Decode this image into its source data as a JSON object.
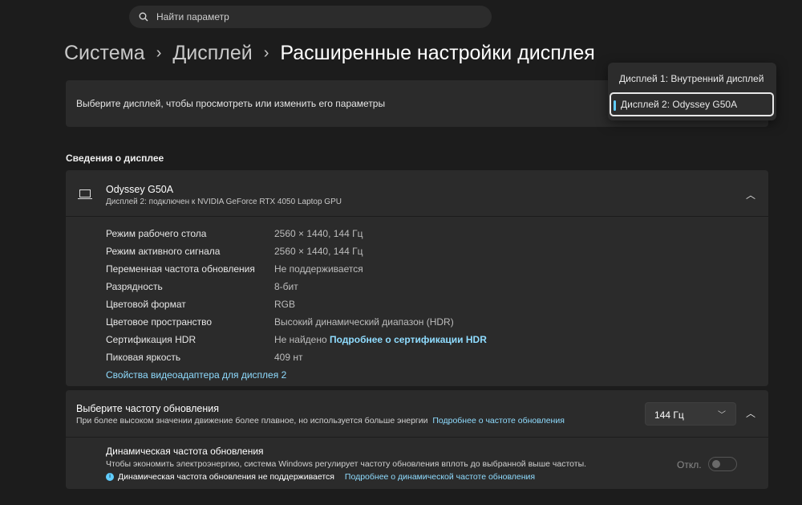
{
  "search": {
    "placeholder": "Найти параметр"
  },
  "breadcrumb": {
    "item1": "Система",
    "item2": "Дисплей",
    "current": "Расширенные настройки дисплея"
  },
  "display_select": {
    "label": "Выберите дисплей, чтобы просмотреть или изменить его параметры",
    "options": [
      "Дисплей 1: Внутренний дисплей",
      "Дисплей 2: Odyssey G50A"
    ],
    "selected": "Дисплей 2: Odyssey G50A"
  },
  "section_title": "Сведения о дисплее",
  "info": {
    "name": "Odyssey G50A",
    "subtitle": "Дисплей 2: подключен к NVIDIA GeForce RTX 4050 Laptop GPU",
    "rows": [
      {
        "k": "Режим рабочего стола",
        "v": "2560 × 1440, 144 Гц"
      },
      {
        "k": "Режим активного сигнала",
        "v": "2560 × 1440, 144 Гц"
      },
      {
        "k": "Переменная частота обновления",
        "v": "Не поддерживается"
      },
      {
        "k": "Разрядность",
        "v": "8-бит"
      },
      {
        "k": "Цветовой формат",
        "v": "RGB"
      },
      {
        "k": "Цветовое пространство",
        "v": "Высокий динамический диапазон (HDR)"
      },
      {
        "k": "Сертификация HDR",
        "v": "Не найдено",
        "link": "Подробнее о сертификации HDR"
      },
      {
        "k": "Пиковая яркость",
        "v": "409 нт"
      }
    ],
    "adapter_link": "Свойства видеоадаптера для дисплея 2"
  },
  "refresh": {
    "title": "Выберите частоту обновления",
    "desc": "При более высоком значении движение более плавное, но используется больше энергии",
    "link": "Подробнее о частоте обновления",
    "value": "144 Гц",
    "dynamic": {
      "title": "Динамическая частота обновления",
      "desc": "Чтобы экономить электроэнергию, система Windows регулирует частоту обновления вплоть до выбранной выше частоты.",
      "note": "Динамическая частота обновления не поддерживается",
      "link": "Подробнее о динамической частоте обновления",
      "toggle_label": "Откл.",
      "on": false
    }
  }
}
